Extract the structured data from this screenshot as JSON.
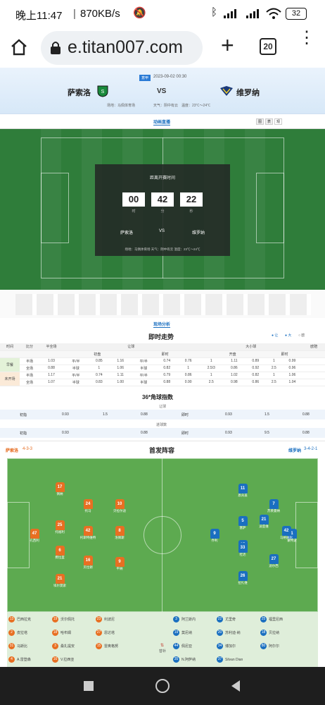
{
  "status": {
    "time": "晚上11:47",
    "speed": "870KB/s",
    "battery": "32"
  },
  "browser": {
    "url": "e.titan007.com",
    "tab_count": "20"
  },
  "match": {
    "badge": "意甲",
    "datetime": "2023-09-02 00:30",
    "home": "萨索洛",
    "vs": "VS",
    "away": "维罗纳",
    "venue": "场地：马佩体育场",
    "weather": "天气：阴中有云",
    "temp": "温度：23℃～24℃"
  },
  "live": {
    "title": "动画直播",
    "tabs": [
      "图",
      "表",
      "观"
    ]
  },
  "countdown": {
    "label": "距离开赛时间",
    "h": "00",
    "m": "42",
    "s": "22",
    "h_unit": "时",
    "m_unit": "分",
    "s_unit": "秒",
    "home": "萨索洛",
    "vs": "VS",
    "away": "维罗纳",
    "info": "场地：马佩体育场 天气：阴中有云 温度：23℃～24℃"
  },
  "analysis": {
    "tab": "现场分析",
    "odds_title": "即时走势",
    "opt_rang": "让",
    "opt_da": "大",
    "opt_ou": "欧"
  },
  "odds": {
    "head": [
      "时间",
      "比分",
      "半全场",
      "让球",
      "",
      "",
      "",
      "",
      "",
      "大小球",
      "",
      "",
      "",
      "",
      "",
      "欧赔",
      "",
      ""
    ],
    "sub": [
      "",
      "",
      "",
      "",
      "初盘",
      "",
      "",
      "即时",
      "",
      "",
      "开盘",
      "",
      "",
      "即时",
      "",
      "",
      ""
    ],
    "rows": [
      [
        "早餐",
        "半场",
        "1.03",
        "平/半",
        "0.85",
        "1.16",
        "平/半",
        "0.74",
        "0.76",
        "1",
        "1.11",
        "0.89",
        "1",
        "0.99"
      ],
      [
        "",
        "全场",
        "0.88",
        "半球",
        "1",
        "1.06",
        "半球",
        "0.82",
        "1",
        "2.5/3",
        "0.86",
        "0.92",
        "2.5",
        "0.96"
      ],
      [
        "未开场",
        "半场",
        "1.17",
        "平/半",
        "0.74",
        "1.11",
        "平/半",
        "0.79",
        "0.86",
        "1",
        "1.02",
        "0.82",
        "1",
        "1.06"
      ],
      [
        "",
        "全场",
        "1.07",
        "半球",
        "0.83",
        "1.00",
        "半球",
        "0.88",
        "0.90",
        "2.5",
        "0.98",
        "0.86",
        "2.5",
        "1.04"
      ]
    ]
  },
  "corner": {
    "title": "36*角球指数",
    "rang": "让球",
    "daxiao": "进球数",
    "row1": [
      "初指",
      "0.93",
      "1.5",
      "0.88",
      "即时",
      "0.93",
      "1.5",
      "0.88"
    ],
    "row2": [
      "初指",
      "0.93",
      "",
      "0.88",
      "即时",
      "0.93",
      "9.5",
      "0.88"
    ]
  },
  "lineup": {
    "title": "首发阵容",
    "home": "萨索洛",
    "home_form": "4-3-3",
    "away": "维罗纳",
    "away_form": "3-4-2-1",
    "home_players": [
      {
        "no": "47",
        "name": "孔西利"
      },
      {
        "no": "25",
        "name": "托福利"
      },
      {
        "no": "6",
        "name": "费拉里"
      },
      {
        "no": "21",
        "name": "埃尔莫索"
      },
      {
        "no": "17",
        "name": "佩纳"
      },
      {
        "no": "42",
        "name": "托斯特维特"
      },
      {
        "no": "8",
        "name": "洛佩斯"
      },
      {
        "no": "16",
        "name": "贝拉谢"
      },
      {
        "no": "24",
        "name": "托马"
      },
      {
        "no": "9",
        "name": "平纳"
      },
      {
        "no": "10",
        "name": "贝拉尔迪"
      }
    ],
    "away_players": [
      {
        "no": "1",
        "name": "蒙特波"
      },
      {
        "no": "21",
        "name": "迪亚维"
      },
      {
        "no": "15",
        "name": "赫伦"
      },
      {
        "no": "42",
        "name": "马格纳尼"
      },
      {
        "no": "26",
        "name": "拉扎维"
      },
      {
        "no": "5",
        "name": "塞萨"
      },
      {
        "no": "33",
        "name": "杜达"
      },
      {
        "no": "27",
        "name": "迪尔西"
      },
      {
        "no": "7",
        "name": "苏莱曼纳"
      },
      {
        "no": "9",
        "name": "乔利"
      },
      {
        "no": "11",
        "name": "恩贡盖"
      }
    ]
  },
  "subs": {
    "label": "替补",
    "home": [
      [
        "13",
        "巴西拉克"
      ],
      [
        "19",
        "沃尔佩托"
      ],
      [
        "23",
        "利波尼"
      ],
      [
        "2",
        "皮拉塔"
      ],
      [
        "18",
        "哈布姆"
      ],
      [
        "27",
        "恩达塔"
      ],
      [
        "31",
        "马斯比"
      ],
      [
        "3",
        "桑扎提安"
      ],
      [
        "15",
        "雷奥格努"
      ],
      [
        "4",
        "A.雷登森"
      ],
      [
        "16",
        "V.拉西亚"
      ]
    ],
    "away": [
      [
        "3",
        "阿兰斯内"
      ],
      [
        "22",
        "尤里奇"
      ],
      [
        "25",
        "福里尼西"
      ],
      [
        "19",
        "莫尼纳"
      ],
      [
        "20",
        "苏利迪·纳"
      ],
      [
        "18",
        "贝拉纳"
      ],
      [
        "44",
        "佩尼亚"
      ],
      [
        "34",
        "博加尔"
      ],
      [
        "80",
        "阿尔尔"
      ],
      [
        "35",
        "N.阿萨纳"
      ],
      [
        "37",
        "Silvan Dian"
      ]
    ]
  }
}
